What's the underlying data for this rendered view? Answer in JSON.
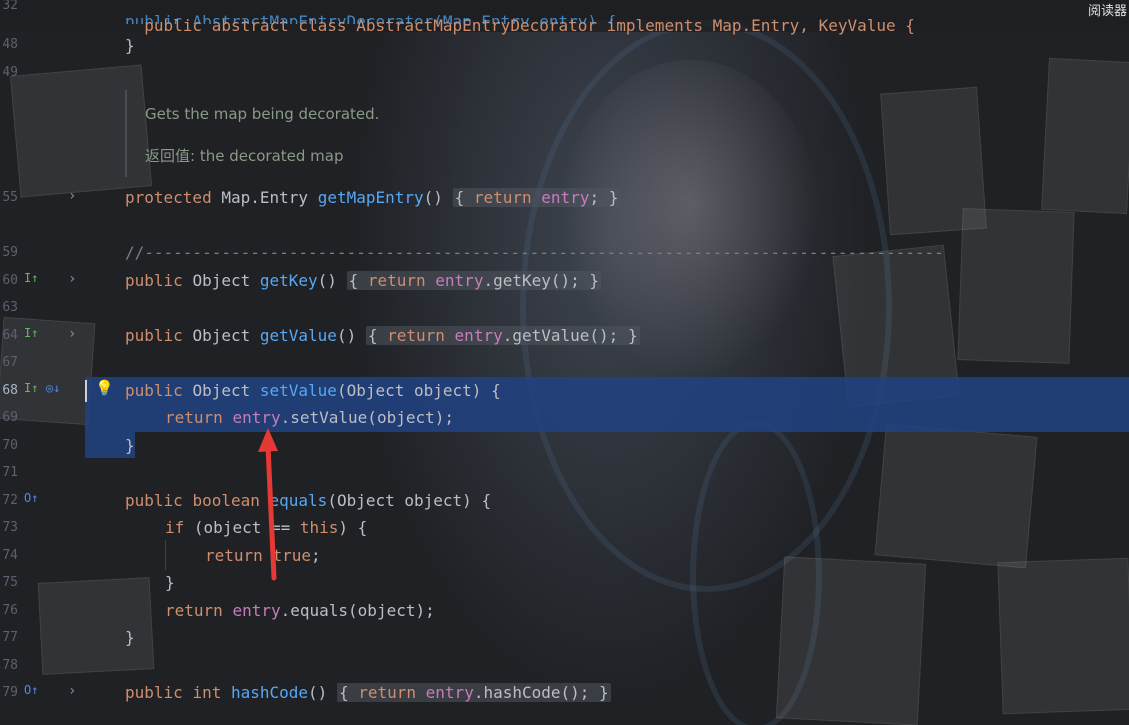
{
  "header": {
    "class_declaration": "public abstract class AbstractMapEntryDecorator implements Map.Entry, KeyValue {",
    "constructor_ghost": "public AbstractMapEntryDecorator(Map.Entry entry) {",
    "reader_mode": "阅读器"
  },
  "line_numbers": {
    "l32": "32",
    "l48": "48",
    "l49": "49",
    "l55": "55",
    "l59": "59",
    "l60": "60",
    "l63": "63",
    "l64": "64",
    "l67": "67",
    "l68": "68",
    "l69": "69",
    "l70": "70",
    "l71": "71",
    "l72": "72",
    "l73": "73",
    "l74": "74",
    "l75": "75",
    "l76": "76",
    "l77": "77",
    "l78": "78",
    "l79": "79"
  },
  "doc": {
    "summary": "Gets the map being decorated.",
    "returns_label": "返回值:",
    "returns_text": "the decorated map"
  },
  "code": {
    "close_brace": "}",
    "getMapEntry": {
      "mod": "protected",
      "type": "Map.Entry",
      "name": "getMapEntry",
      "parens": "()",
      "kw_return": "return",
      "field": "entry",
      "semi": ";"
    },
    "separator": "//-----------------------------------------------------------------------------------",
    "getKey": {
      "mod": "public",
      "type": "Object",
      "name": "getKey",
      "parens": "()",
      "kw_return": "return",
      "field": "entry",
      "call": ".getKey();"
    },
    "getValue": {
      "mod": "public",
      "type": "Object",
      "name": "getValue",
      "parens": "()",
      "kw_return": "return",
      "field": "entry",
      "call": ".getValue();"
    },
    "setValue": {
      "mod": "public",
      "type": "Object",
      "name": "setValue",
      "params": "(Object object) {",
      "kw_return": "return",
      "field": "entry",
      "call": ".setValue(object);"
    },
    "equals": {
      "mod": "public",
      "type": "boolean",
      "name": "equals",
      "params": "(Object object) {",
      "kw_if": "if",
      "cond_a": "(object == ",
      "kw_this": "this",
      "cond_b": ") {",
      "kw_return": "return",
      "kw_true": "true",
      "semi": ";",
      "field": "entry",
      "call": ".equals(object);"
    },
    "hashCode": {
      "mod": "public",
      "type": "int",
      "name": "hashCode",
      "parens": "()",
      "kw_return": "return",
      "field": "entry",
      "call": ".hashCode();"
    }
  },
  "icons": {
    "implements_marker": "I↑",
    "override_marker": "O↑",
    "fold_chevron": "›",
    "bulb": "💡"
  },
  "colors": {
    "keyword": "#cf8e6d",
    "method": "#56a8f5",
    "field": "#c77dbb",
    "plain": "#bcbec4",
    "comment": "#7a7e85",
    "selection": "#214283",
    "annotation_arrow": "#e53935",
    "gutter_marker_green": "#5fb865",
    "gutter_marker_blue": "#4d8bf0"
  }
}
